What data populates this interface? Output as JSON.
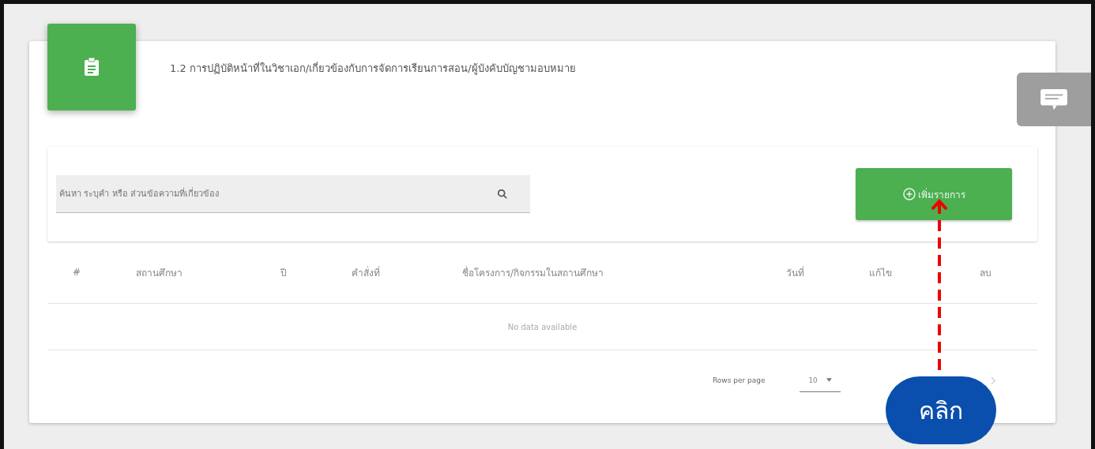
{
  "header": {
    "title": "1.2 การปฏิบัติหน้าที่ในวิชาเอก/เกี่ยวข้องกับการจัดการเรียนการสอน/ผู้บังคับบัญชามอบหมาย"
  },
  "search": {
    "placeholder": "ค้นหา ระบุคำ หรือ ส่วนข้อความที่เกี่ยวข้อง"
  },
  "add_button": {
    "label": "เพิ่มรายการ"
  },
  "table": {
    "columns": [
      "#",
      "สถานศึกษา",
      "ปี",
      "คำสั่งที่",
      "ชื่อโครงการ/กิจกรรมในสถานศึกษา",
      "วันที่",
      "แก้ไข",
      "ลบ"
    ],
    "empty_text": "No data available"
  },
  "footer": {
    "rows_per_page_label": "Rows per page",
    "rows_per_page": "10"
  },
  "callout": {
    "label": "คลิก"
  }
}
